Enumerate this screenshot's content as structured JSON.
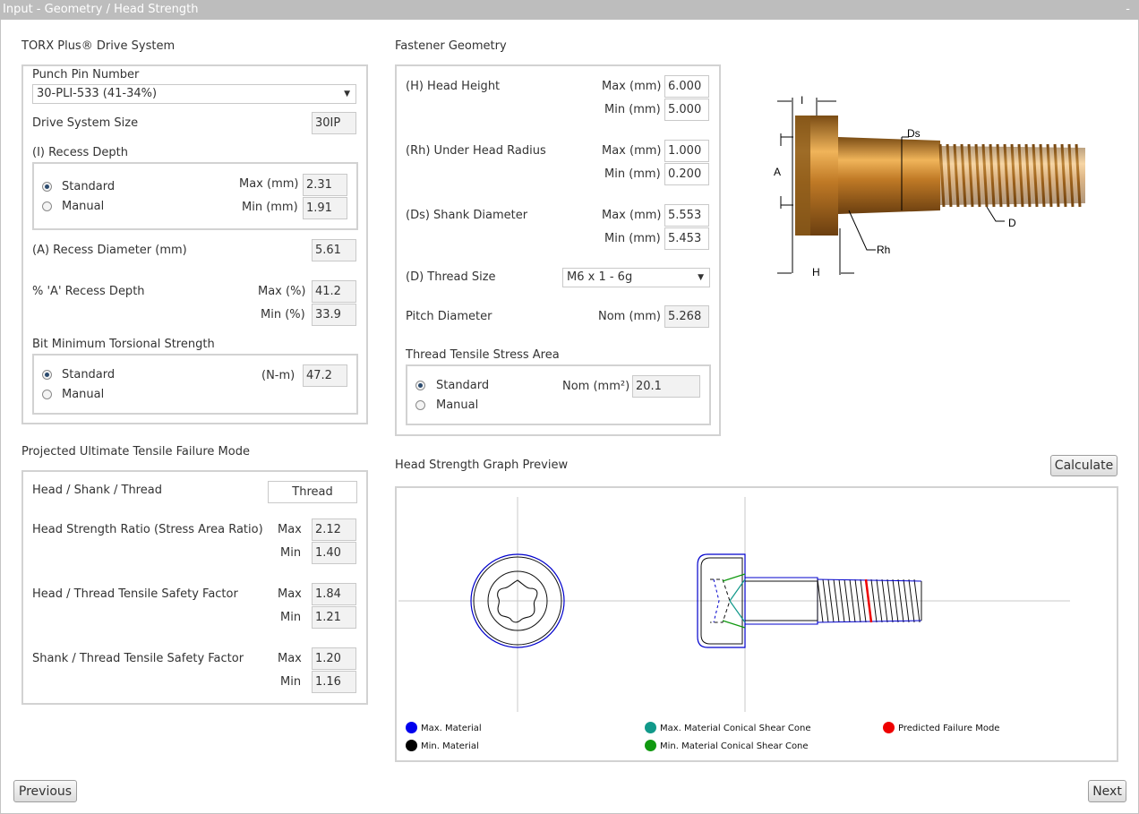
{
  "window": {
    "title": "Input - Geometry / Head Strength",
    "minimize_label": "-"
  },
  "drive": {
    "section_title": "TORX Plus® Drive System",
    "punch_pin_label": "Punch Pin Number",
    "punch_pin_value": "30-PLI-533 (41-34%)",
    "drive_size_label": "Drive System Size",
    "drive_size_value": "30IP",
    "recess_depth": {
      "title": "(I) Recess Depth",
      "standard_label": "Standard",
      "manual_label": "Manual",
      "selected": "Standard",
      "max_label": "Max (mm)",
      "max_value": "2.31",
      "min_label": "Min (mm)",
      "min_value": "1.91"
    },
    "recess_diameter_label": "(A) Recess Diameter (mm)",
    "recess_diameter_value": "5.61",
    "pct_recess": {
      "label": "% 'A' Recess Depth",
      "max_label": "Max (%)",
      "max_value": "41.2",
      "min_label": "Min (%)",
      "min_value": "33.9"
    },
    "bit_strength": {
      "title": "Bit Minimum Torsional Strength",
      "standard_label": "Standard",
      "manual_label": "Manual",
      "selected": "Standard",
      "unit_label": "(N-m)",
      "value": "47.2"
    }
  },
  "fastener": {
    "section_title": "Fastener Geometry",
    "head_height": {
      "label": "(H) Head Height",
      "max_label": "Max (mm)",
      "max_value": "6.000",
      "min_label": "Min (mm)",
      "min_value": "5.000"
    },
    "under_head_radius": {
      "label": "(Rh) Under Head Radius",
      "max_label": "Max (mm)",
      "max_value": "1.000",
      "min_label": "Min (mm)",
      "min_value": "0.200"
    },
    "shank_diameter": {
      "label": "(Ds) Shank Diameter",
      "max_label": "Max (mm)",
      "max_value": "5.553",
      "min_label": "Min (mm)",
      "min_value": "5.453"
    },
    "thread_size_label": "(D) Thread Size",
    "thread_size_value": "M6 x 1 - 6g",
    "pitch_label": "Pitch Diameter",
    "pitch_unit": "Nom (mm)",
    "pitch_value": "5.268",
    "stress_area": {
      "title": "Thread Tensile Stress Area",
      "standard_label": "Standard",
      "manual_label": "Manual",
      "selected": "Standard",
      "unit_label": "Nom (mm²)",
      "value": "20.1"
    }
  },
  "diagram_labels": {
    "I": "I",
    "Ds": "Ds",
    "A": "A",
    "D": "D",
    "Rh": "Rh",
    "H": "H"
  },
  "failure": {
    "section_title": "Projected Ultimate Tensile Failure Mode",
    "mode_label": "Head / Shank / Thread",
    "mode_value": "Thread",
    "ratio": {
      "label": "Head Strength Ratio (Stress Area Ratio)",
      "max_label": "Max",
      "max_value": "2.12",
      "min_label": "Min",
      "min_value": "1.40"
    },
    "head_thread_sf": {
      "label": "Head / Thread Tensile Safety Factor",
      "max_label": "Max",
      "max_value": "1.84",
      "min_label": "Min",
      "min_value": "1.21"
    },
    "shank_thread_sf": {
      "label": "Shank / Thread Tensile Safety Factor",
      "max_label": "Max",
      "max_value": "1.20",
      "min_label": "Min",
      "min_value": "1.16"
    }
  },
  "graph": {
    "section_title": "Head Strength Graph Preview",
    "calculate_label": "Calculate",
    "legend": [
      {
        "label": "Max. Material",
        "color": "#0000ee"
      },
      {
        "label": "Min. Material",
        "color": "#000000"
      },
      {
        "label": "Max. Material Conical Shear Cone",
        "color": "#11998a"
      },
      {
        "label": "Min. Material Conical Shear Cone",
        "color": "#119911"
      },
      {
        "label": "Predicted Failure Mode",
        "color": "#ee0000"
      }
    ]
  },
  "nav": {
    "previous_label": "Previous",
    "next_label": "Next"
  }
}
